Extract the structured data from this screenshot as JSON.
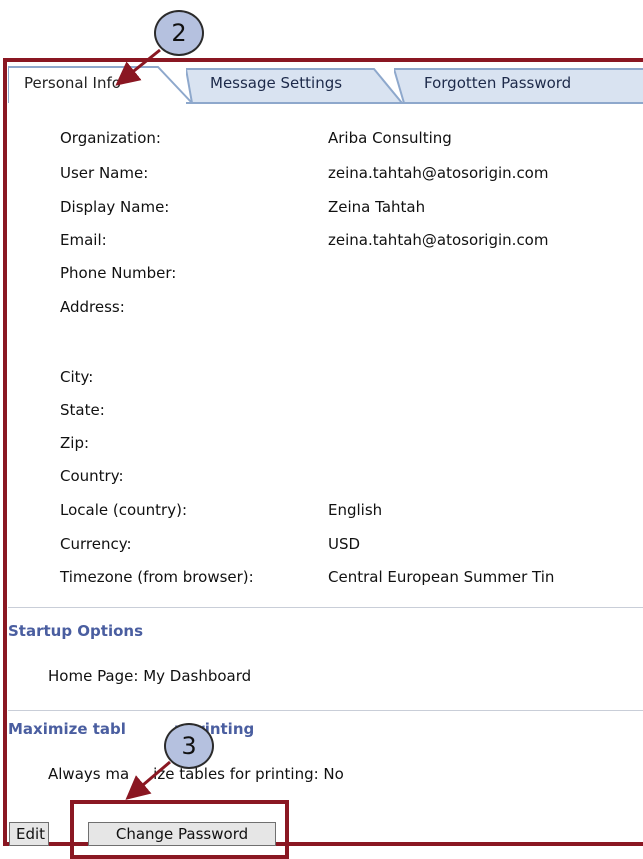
{
  "tabs": [
    {
      "label": "Personal Info"
    },
    {
      "label": "Message Settings"
    },
    {
      "label": "Forgotten Password"
    }
  ],
  "profile": [
    {
      "label": "Organization:",
      "value": "Ariba Consulting"
    },
    {
      "label": "User Name:",
      "value": "zeina.tahtah@atosorigin.com"
    },
    {
      "label": "Display Name:",
      "value": "Zeina Tahtah"
    },
    {
      "label": "Email:",
      "value": "zeina.tahtah@atosorigin.com"
    },
    {
      "label": "Phone Number:",
      "value": ""
    },
    {
      "label": "Address:",
      "value": ""
    },
    {
      "label": "City:",
      "value": ""
    },
    {
      "label": "State:",
      "value": ""
    },
    {
      "label": "Zip:",
      "value": ""
    },
    {
      "label": "Country:",
      "value": ""
    },
    {
      "label": "Locale (country):",
      "value": "English"
    },
    {
      "label": "Currency:",
      "value": "USD"
    },
    {
      "label": "Timezone (from browser):",
      "value": "Central European Summer Tin"
    }
  ],
  "startup": {
    "heading": "Startup Options",
    "home_page_text": "Home Page:  My Dashboard"
  },
  "maximize": {
    "heading": "Maximize tabl",
    "heading_tail": "r printing",
    "text_a": "Always ma",
    "text_b": "ize tables for printing: No"
  },
  "buttons": {
    "edit": "Edit",
    "change_password": "Change Password"
  },
  "callouts": {
    "step2": "2",
    "step3": "3"
  },
  "colors": {
    "frame": "#8a1722",
    "callout_fill": "#b5c1df",
    "section_heading": "#4a5ea0"
  }
}
